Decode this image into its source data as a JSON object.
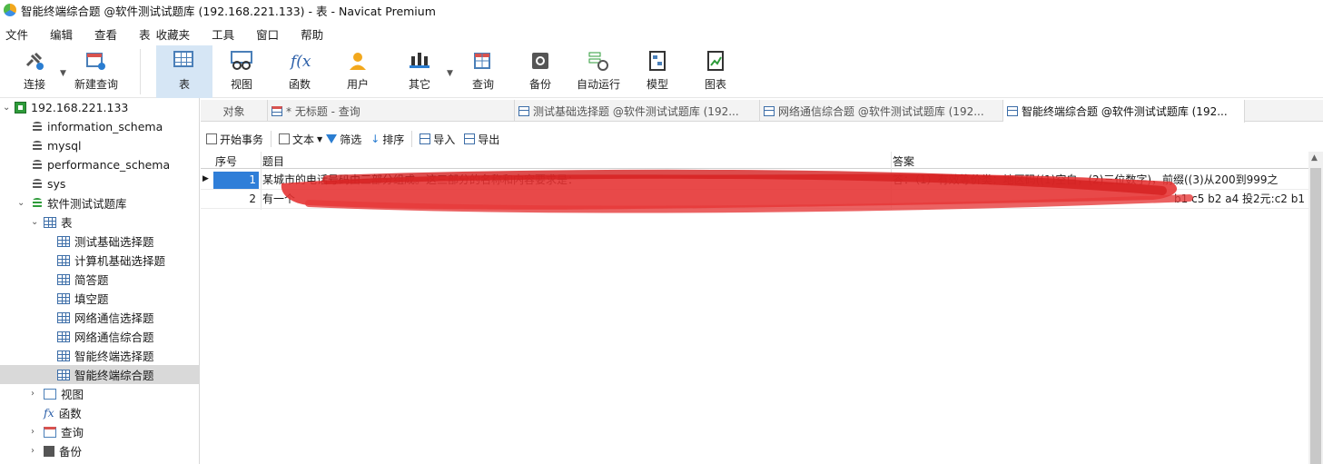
{
  "window": {
    "title": "智能终端综合题 @软件测试试题库 (192.168.221.133) - 表 - Navicat Premium"
  },
  "menu": [
    "文件",
    "编辑",
    "查看",
    "表",
    "收藏夹",
    "工具",
    "窗口",
    "帮助"
  ],
  "toolbar": {
    "connect": "连接",
    "new_query": "新建查询",
    "table": "表",
    "view": "视图",
    "function": "函数",
    "user": "用户",
    "other": "其它",
    "query": "查询",
    "backup": "备份",
    "auto_run": "自动运行",
    "model": "模型",
    "chart": "图表"
  },
  "tree": {
    "server": "192.168.221.133",
    "databases": [
      "information_schema",
      "mysql",
      "performance_schema",
      "sys"
    ],
    "active_db": "软件测试试题库",
    "tables_label": "表",
    "tables": [
      "测试基础选择题",
      "计算机基础选择题",
      "简答题",
      "填空题",
      "网络通信选择题",
      "网络通信综合题",
      "智能终端选择题",
      "智能终端综合题"
    ],
    "views_label": "视图",
    "functions_label": "函数",
    "queries_label": "查询",
    "backups_label": "备份"
  },
  "tabs": {
    "objects": "对象",
    "untitled": "* 无标题 - 查询",
    "tab1": "测试基础选择题 @软件测试试题库 (192...",
    "tab2": "网络通信综合题 @软件测试试题库 (192...",
    "tab3": "智能终端综合题 @软件测试试题库 (192..."
  },
  "subtoolbar": {
    "begin_tx": "开始事务",
    "text": "文本",
    "filter": "筛选",
    "sort": "排序",
    "import": "导入",
    "export": "导出"
  },
  "grid": {
    "headers": {
      "id": "序号",
      "question": "题目",
      "answer": "答案"
    },
    "rows": [
      {
        "id": "1",
        "question": "某城市的电话号码由三部分组成。这三部分的名称和内容要求是：",
        "answer": "答：（1）有效等价类：地区码((1)空白，(2)三位数字)，前缀((3)从200到999之"
      },
      {
        "id": "2",
        "question": "有一个",
        "answer": "b1 c5 b2 a4 投2元:c2 b1"
      }
    ]
  },
  "colors": {
    "selection": "#2f7ed8",
    "active_toolbar": "#d6e6f5",
    "redaction": "#e53030"
  }
}
